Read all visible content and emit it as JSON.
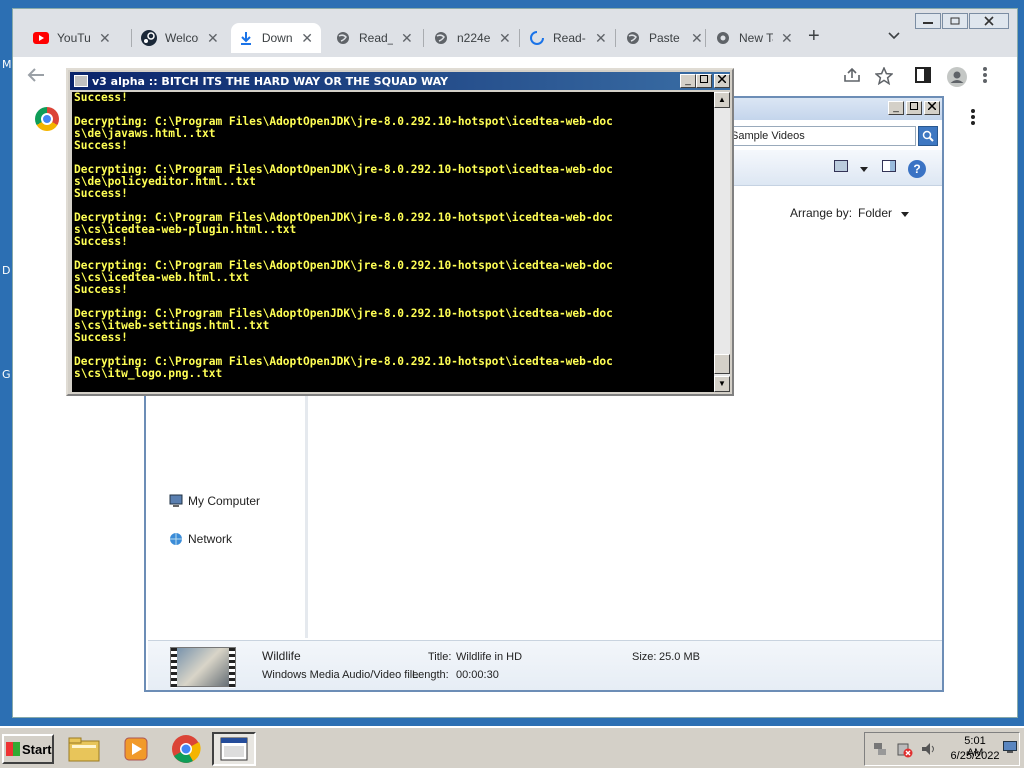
{
  "desktop": {
    "label_1": "M",
    "label_2": "D",
    "label_3": "G"
  },
  "chrome": {
    "tabs": [
      {
        "title": "YouTube",
        "icon": "youtube-icon"
      },
      {
        "title": "Welcome",
        "icon": "steam-icon"
      },
      {
        "title": "Downloads",
        "icon": "download-icon",
        "active": true
      },
      {
        "title": "Read_",
        "icon": "globe-icon"
      },
      {
        "title": "n224e",
        "icon": "globe-icon"
      },
      {
        "title": "Read-",
        "icon": "loading-icon"
      },
      {
        "title": "Paste",
        "icon": "globe-icon"
      },
      {
        "title": "New Tab",
        "icon": "chrome-icon"
      }
    ],
    "new_tab": "+",
    "tab_search": "⌄",
    "close_glyph": "✕"
  },
  "console": {
    "title": "v3 alpha :: BITCH ITS THE HARD WAY OR THE SQUAD WAY",
    "lines": [
      "Success!",
      "",
      "Decrypting: C:\\Program Files\\AdoptOpenJDK\\jre-8.0.292.10-hotspot\\icedtea-web-doc",
      "s\\de\\javaws.html..txt",
      "Success!",
      "",
      "Decrypting: C:\\Program Files\\AdoptOpenJDK\\jre-8.0.292.10-hotspot\\icedtea-web-doc",
      "s\\de\\policyeditor.html..txt",
      "Success!",
      "",
      "Decrypting: C:\\Program Files\\AdoptOpenJDK\\jre-8.0.292.10-hotspot\\icedtea-web-doc",
      "s\\cs\\icedtea-web-plugin.html..txt",
      "Success!",
      "",
      "Decrypting: C:\\Program Files\\AdoptOpenJDK\\jre-8.0.292.10-hotspot\\icedtea-web-doc",
      "s\\cs\\icedtea-web.html..txt",
      "Success!",
      "",
      "Decrypting: C:\\Program Files\\AdoptOpenJDK\\jre-8.0.292.10-hotspot\\icedtea-web-doc",
      "s\\cs\\itweb-settings.html..txt",
      "Success!",
      "",
      "Decrypting: C:\\Program Files\\AdoptOpenJDK\\jre-8.0.292.10-hotspot\\icedtea-web-doc",
      "s\\cs\\itw_logo.png..txt"
    ]
  },
  "explorer": {
    "search_value": "Sample Videos",
    "arrange_label": "Arrange by:",
    "arrange_value": "Folder",
    "nav": [
      {
        "label": "My Computer",
        "icon": "computer-icon"
      },
      {
        "label": "Network",
        "icon": "network-icon"
      }
    ],
    "details": {
      "name": "Wildlife",
      "type": "Windows Media Audio/Video file",
      "title_label": "Title:",
      "title_value": "Wildlife in HD",
      "size_label": "Size:",
      "size_value": "25.0 MB",
      "length_label": "Length:",
      "length_value": "00:00:30"
    }
  },
  "taskbar": {
    "start_label": "Start",
    "apps": [
      "file-explorer-icon",
      "media-player-icon",
      "chrome-icon",
      "console-icon"
    ],
    "clock_time": "5:01 AM",
    "clock_date": "6/25/2022"
  }
}
